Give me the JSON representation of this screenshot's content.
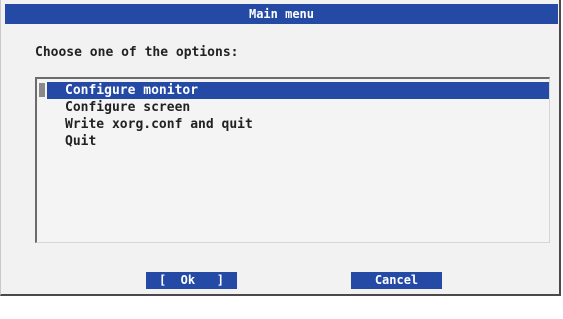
{
  "dialog": {
    "title": "Main menu",
    "prompt": "Choose one of the options:",
    "options": [
      "Configure monitor",
      "Configure screen",
      "Write xorg.conf and quit",
      "Quit"
    ],
    "selected_index": 0
  },
  "buttons": {
    "ok_label": "[  Ok   ]",
    "cancel_label": "Cancel"
  },
  "colors": {
    "accent": "#244aa6",
    "background": "#f2f2f2"
  }
}
